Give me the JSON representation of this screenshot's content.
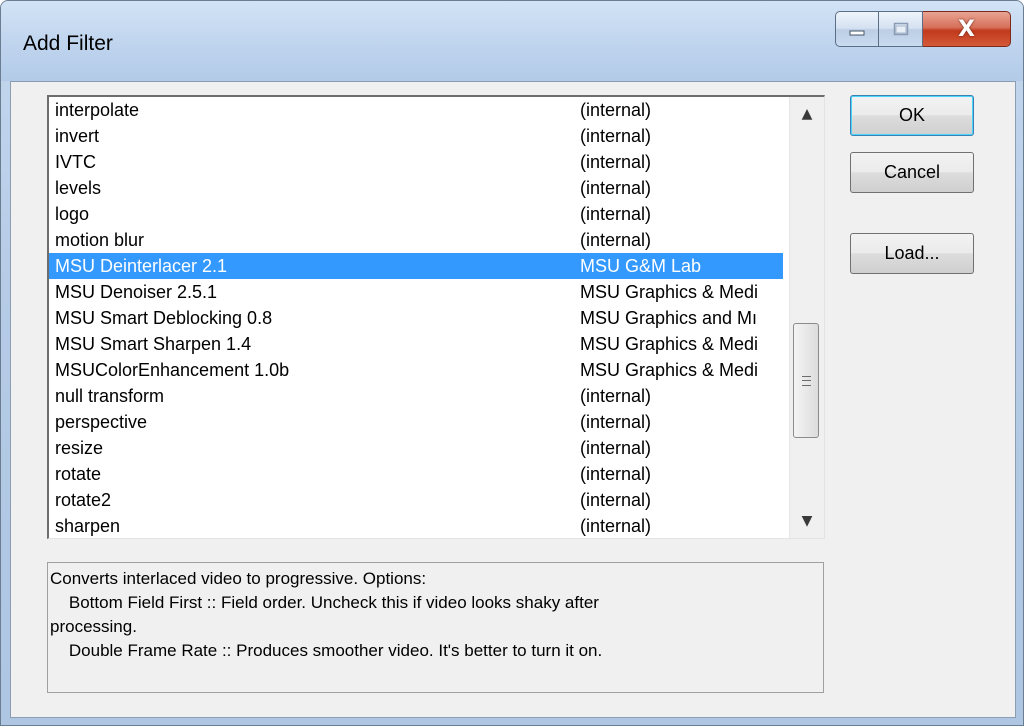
{
  "window": {
    "title": "Add Filter",
    "close_glyph": "X"
  },
  "filters": [
    {
      "name": "interpolate",
      "author": "(internal)"
    },
    {
      "name": "invert",
      "author": "(internal)"
    },
    {
      "name": "IVTC",
      "author": "(internal)"
    },
    {
      "name": "levels",
      "author": "(internal)"
    },
    {
      "name": "logo",
      "author": "(internal)"
    },
    {
      "name": "motion blur",
      "author": "(internal)"
    },
    {
      "name": "MSU Deinterlacer 2.1",
      "author": "MSU G&M Lab"
    },
    {
      "name": "MSU Denoiser 2.5.1",
      "author": "MSU Graphics & Medi"
    },
    {
      "name": "MSU Smart Deblocking 0.8",
      "author": "MSU Graphics and Mı"
    },
    {
      "name": "MSU Smart Sharpen 1.4",
      "author": "MSU Graphics & Medi"
    },
    {
      "name": "MSUColorEnhancement 1.0b",
      "author": "MSU Graphics & Medi"
    },
    {
      "name": "null transform",
      "author": "(internal)"
    },
    {
      "name": "perspective",
      "author": "(internal)"
    },
    {
      "name": "resize",
      "author": "(internal)"
    },
    {
      "name": "rotate",
      "author": "(internal)"
    },
    {
      "name": "rotate2",
      "author": "(internal)"
    },
    {
      "name": "sharpen",
      "author": "(internal)"
    }
  ],
  "selected_filter": "MSU Deinterlacer 2.1",
  "buttons": {
    "ok": "OK",
    "cancel": "Cancel",
    "load": "Load..."
  },
  "description": {
    "lines": [
      "Converts interlaced video to progressive. Options:",
      "    Bottom Field First :: Field order. Uncheck this if video looks shaky after",
      "processing.",
      "    Double Frame Rate :: Produces smoother video. It's better to turn it on."
    ]
  },
  "colors": {
    "selection": "#3399ff",
    "close_button": "#c2391c"
  }
}
